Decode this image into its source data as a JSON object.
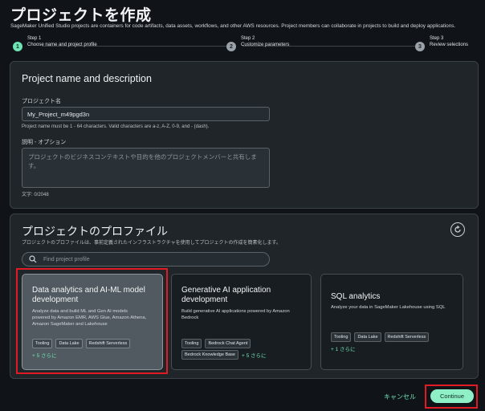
{
  "header": {
    "title": "プロジェクトを作成",
    "subtitle": "SageMaker Unified Studio projects are containers for code artifacts, data assets, workflows, and other AWS resources. Project members can collaborate in projects to build and deploy applications."
  },
  "stepper": {
    "steps": [
      {
        "number": "1",
        "step": "Step 1",
        "label": "Choose name and project profile",
        "state": "active"
      },
      {
        "number": "2",
        "step": "Step 2",
        "label": "Customize parameters",
        "state": "inactive"
      },
      {
        "number": "3",
        "step": "Step 3",
        "label": "Review selections",
        "state": "inactive"
      }
    ]
  },
  "name_panel": {
    "title": "Project name and description",
    "name_label": "プロジェクト名",
    "name_value": "My_Project_m49pgd3n",
    "name_help": "Project name must be 1 - 64 characters. Valid characters are a-z, A-Z, 0-9, and - (dash).",
    "desc_label": "説明 - オプション",
    "desc_placeholder": "プロジェクトのビジネスコンテキストや目的を他のプロジェクトメンバーと共有します。",
    "char_count": "文字: 0/2048"
  },
  "profile_panel": {
    "title": "プロジェクトのプロファイル",
    "help": "プロジェクトのプロファイルは、事前定義されたインフラストラクチャを使用してプロジェクトの作成を簡素化します。",
    "search_placeholder": "Find project profile",
    "cards": [
      {
        "title_line1": "Data analytics and AI-ML model",
        "title_line2": "development",
        "desc_line1": "Analyze data and build ML and Gen AI models",
        "desc_line2": "powered by Amazon EMR, AWS Glue, Amazon Athena,",
        "desc_line3": "Amazon SageMaker and Lakehouse",
        "tags": [
          "Tooling",
          "Data Lake",
          "Redshift Serverless"
        ],
        "more": "+ 5 さらに"
      },
      {
        "title_line1": "Generative AI application",
        "title_line2": "development",
        "desc_line1": "Build generative AI applications powered by Amazon",
        "desc_line2": "Bedrock",
        "tags": [
          "Tooling",
          "Bedrock Chat Agent"
        ],
        "tag_row2": "Bedrock Knowledge Base",
        "more": "+ 5 さらに"
      },
      {
        "title_line1": "SQL analytics",
        "desc_line1": "Analyze your data in SageMaker Lakehouse using SQL",
        "tags": [
          "Tooling",
          "Data Lake",
          "Redshift Serverless"
        ],
        "more": "+ 1 さらに"
      }
    ]
  },
  "footer": {
    "cancel_label": "キャンセル",
    "continue_label": "Continue"
  },
  "colors": {
    "accent": "#6fe3b4",
    "highlight": "#e01b24",
    "background": "#101418"
  }
}
